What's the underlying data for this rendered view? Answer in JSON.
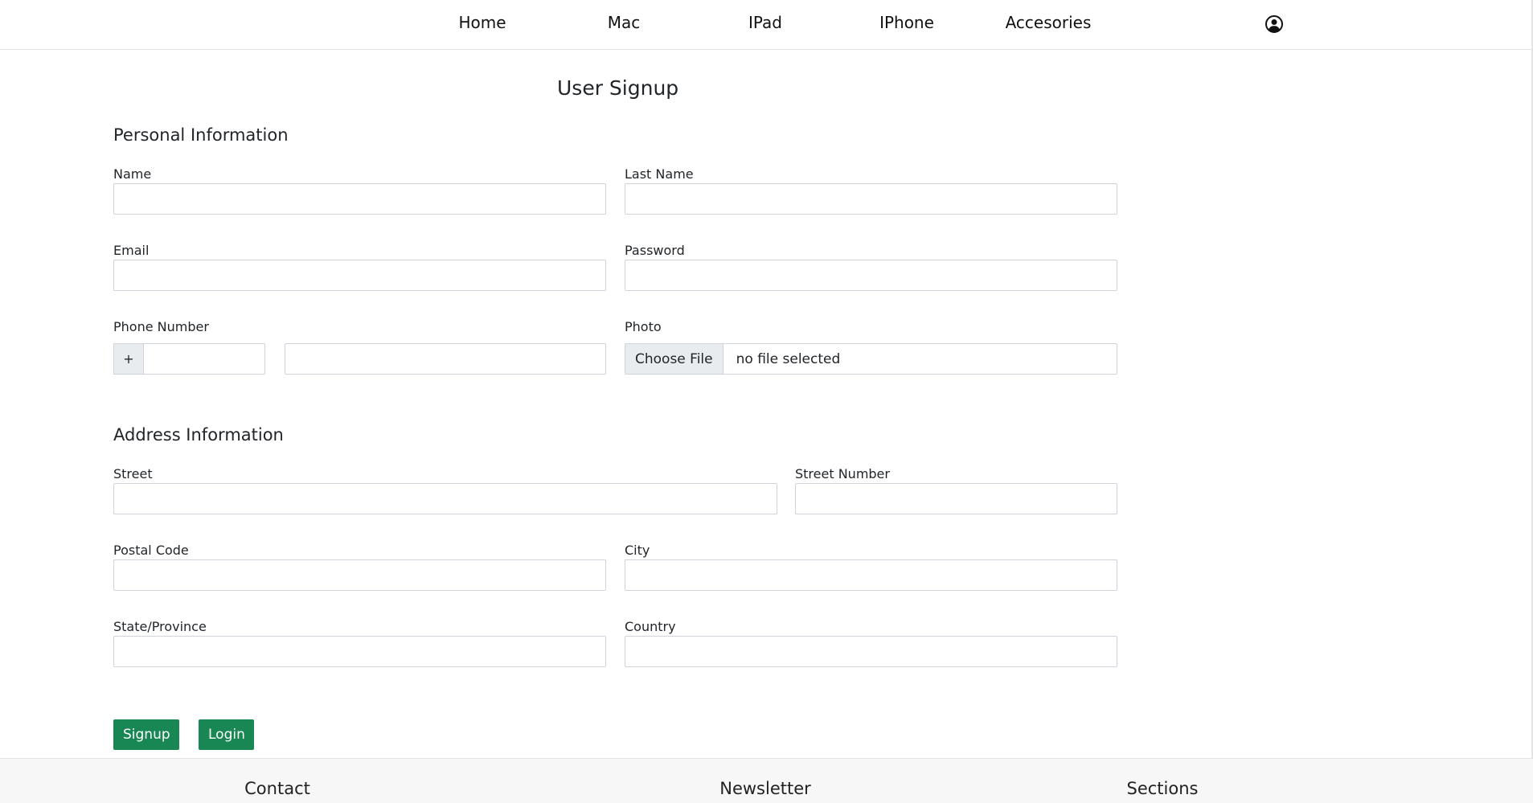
{
  "nav": {
    "items": [
      {
        "label": "Home"
      },
      {
        "label": "Mac"
      },
      {
        "label": "IPad"
      },
      {
        "label": "IPhone"
      },
      {
        "label": "Accesories"
      }
    ],
    "user_icon": "user-circle-icon"
  },
  "page": {
    "title": "User Signup"
  },
  "personal": {
    "title": "Personal Information",
    "name_label": "Name",
    "name_value": "",
    "last_name_label": "Last Name",
    "last_name_value": "",
    "email_label": "Email",
    "email_value": "",
    "password_label": "Password",
    "password_value": "",
    "phone_label": "Phone Number",
    "phone_prefix": "+",
    "phone_code_value": "",
    "phone_number_value": "",
    "photo_label": "Photo",
    "photo_button": "Choose File",
    "photo_status": "no file selected"
  },
  "address": {
    "title": "Address Information",
    "street_label": "Street",
    "street_value": "",
    "street_number_label": "Street Number",
    "street_number_value": "",
    "postal_label": "Postal Code",
    "postal_value": "",
    "city_label": "City",
    "city_value": "",
    "state_label": "State/Province",
    "state_value": "",
    "country_label": "Country",
    "country_value": ""
  },
  "actions": {
    "signup": "Signup",
    "login": "Login"
  },
  "footer": {
    "contact": "Contact",
    "newsletter": "Newsletter",
    "sections": "Sections"
  },
  "colors": {
    "primary_button": "#198754",
    "footer_bg": "#f7f7f8",
    "input_border": "#ced4da"
  }
}
